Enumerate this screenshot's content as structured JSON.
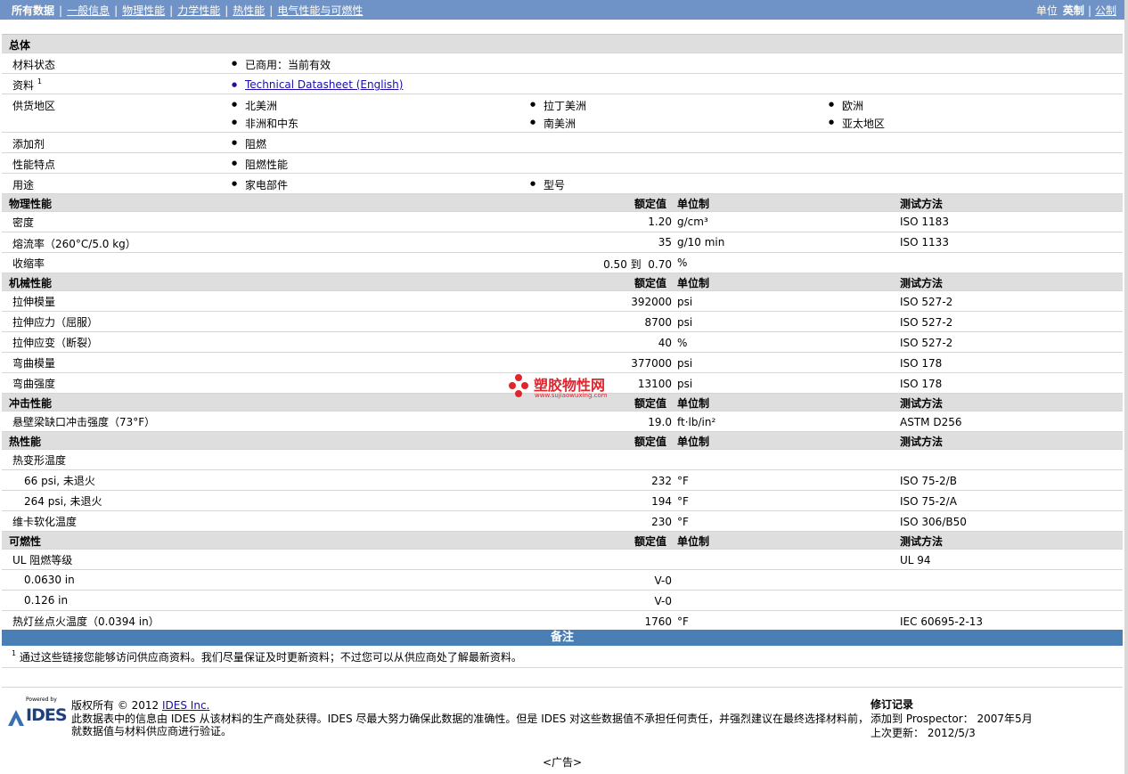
{
  "nav": {
    "all_data": "所有数据",
    "general": "一般信息",
    "physical": "物理性能",
    "mechanical": "力学性能",
    "thermal": "热性能",
    "electrical": "电气性能与可燃性",
    "units_label": "单位",
    "english": "英制",
    "metric": "公制"
  },
  "general": {
    "title": "总体",
    "status_label": "材料状态",
    "status_value": "已商用：当前有效",
    "source_label": "资料",
    "source_sup": "1",
    "source_link": "Technical Datasheet (English)",
    "region_label": "供货地区",
    "regions": [
      "北美洲",
      "拉丁美洲",
      "欧洲",
      "非洲和中东",
      "南美洲",
      "亚太地区"
    ],
    "additive_label": "添加剂",
    "additive_value": "阻燃",
    "feature_label": "性能特点",
    "feature_value": "阻燃性能",
    "use_label": "用途",
    "uses": [
      "家电部件",
      "型号"
    ]
  },
  "col_headers": {
    "nominal": "额定值",
    "unit": "单位制",
    "method": "测试方法"
  },
  "physical": {
    "title": "物理性能",
    "rows": [
      {
        "name": "密度",
        "value": "1.20",
        "unit": "g/cm³",
        "method": "ISO 1183"
      },
      {
        "name": "熔流率（260°C/5.0 kg）",
        "value": "35",
        "unit": "g/10 min",
        "method": "ISO 1133"
      },
      {
        "name": "收缩率",
        "value": "0.50 到  0.70",
        "unit": "%",
        "method": ""
      }
    ]
  },
  "mechanical": {
    "title": "机械性能",
    "rows": [
      {
        "name": "拉伸模量",
        "value": "392000",
        "unit": "psi",
        "method": "ISO 527-2"
      },
      {
        "name": "拉伸应力（屈服）",
        "value": "8700",
        "unit": "psi",
        "method": "ISO 527-2"
      },
      {
        "name": "拉伸应变（断裂）",
        "value": "40",
        "unit": "%",
        "method": "ISO 527-2"
      },
      {
        "name": "弯曲模量",
        "value": "377000",
        "unit": "psi",
        "method": "ISO 178"
      },
      {
        "name": "弯曲强度",
        "value": "13100",
        "unit": "psi",
        "method": "ISO 178"
      }
    ]
  },
  "impact": {
    "title": "冲击性能",
    "rows": [
      {
        "name": "悬壁梁缺口冲击强度（73°F）",
        "value": "19.0",
        "unit": "ft·lb/in²",
        "method": "ASTM D256"
      }
    ]
  },
  "thermal": {
    "title": "热性能",
    "rows": [
      {
        "name": "热变形温度",
        "value": "",
        "unit": "",
        "method": ""
      },
      {
        "name": "66 psi, 未退火",
        "value": "232",
        "unit": "°F",
        "method": "ISO 75-2/B"
      },
      {
        "name": "264 psi, 未退火",
        "value": "194",
        "unit": "°F",
        "method": "ISO 75-2/A"
      },
      {
        "name": "维卡软化温度",
        "value": "230",
        "unit": "°F",
        "method": "ISO 306/B50"
      }
    ]
  },
  "flammability": {
    "title": "可燃性",
    "rows": [
      {
        "name": "UL 阻燃等级",
        "value": "",
        "unit": "",
        "method": "UL 94"
      },
      {
        "name": "0.0630 in",
        "value": "V-0",
        "unit": "",
        "method": ""
      },
      {
        "name": "0.126 in",
        "value": "V-0",
        "unit": "",
        "method": ""
      },
      {
        "name": "热灯丝点火温度（0.0394 in）",
        "value": "1760",
        "unit": "°F",
        "method": "IEC 60695-2-13"
      }
    ]
  },
  "notes": {
    "title": "备注",
    "sup": "1",
    "text": "通过这些链接您能够访问供应商资料。我们尽量保证及时更新资料；不过您可以从供应商处了解最新资料。"
  },
  "footer": {
    "powered": "Powered by",
    "logo": "IDES",
    "copyright_prefix": "版权所有 © 2012",
    "company": "IDES Inc.",
    "disclaimer1": "此数据表中的信息由 IDES 从该材料的生产商处获得。IDES 尽最大努力确保此数据的准确性。但是 IDES 对这些数据值不承担任何责任，并强烈建议在最终选择材料前，",
    "disclaimer2": "就数据值与材料供应商进行验证。",
    "revision_title": "修订记录",
    "added_label": "添加到 Prospector：",
    "added_value": "2007年5月",
    "updated_label": "上次更新：",
    "updated_value": "2012/5/3"
  },
  "watermark": {
    "title": "塑胶物性网",
    "url": "www.sujiaowuxing.com"
  },
  "ad": "<广告>"
}
